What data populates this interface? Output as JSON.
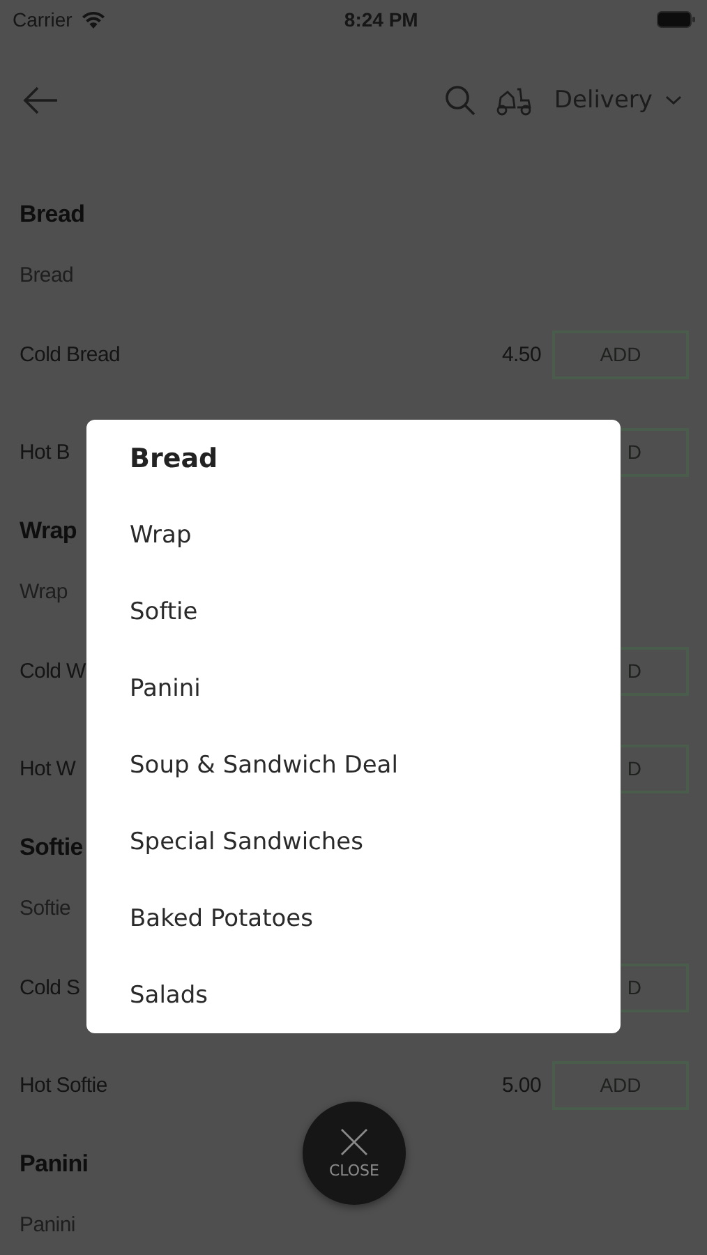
{
  "status_bar": {
    "carrier": "Carrier",
    "time": "8:24 PM"
  },
  "header": {
    "mode_label": "Delivery"
  },
  "menu": {
    "sections": [
      {
        "title": "Bread",
        "subtitle": "Bread",
        "items": [
          {
            "name": "Cold Bread",
            "price": "4.50",
            "add_label": "ADD",
            "covered": false
          },
          {
            "name": "Hot B",
            "add_label": "D",
            "covered": true
          }
        ]
      },
      {
        "title": "Wrap",
        "subtitle": "Wrap",
        "items": [
          {
            "name": "Cold W",
            "add_label": "D",
            "covered": true
          },
          {
            "name": "Hot W",
            "add_label": "D",
            "covered": true
          }
        ]
      },
      {
        "title": "Softie",
        "subtitle": "Softie",
        "items": [
          {
            "name": "Cold S",
            "add_label": "D",
            "covered": true
          },
          {
            "name": "Hot Softie",
            "price": "5.00",
            "add_label": "ADD",
            "covered": false
          }
        ]
      },
      {
        "title": "Panini",
        "subtitle": "Panini"
      }
    ]
  },
  "category_popup": {
    "items": [
      {
        "label": "Bread",
        "selected": true
      },
      {
        "label": "Wrap",
        "selected": false
      },
      {
        "label": "Softie",
        "selected": false
      },
      {
        "label": "Panini",
        "selected": false
      },
      {
        "label": "Soup & Sandwich Deal",
        "selected": false
      },
      {
        "label": "Special Sandwiches",
        "selected": false
      },
      {
        "label": "Baked Potatoes",
        "selected": false
      },
      {
        "label": "Salads",
        "selected": false
      }
    ]
  },
  "close_button": {
    "label": "CLOSE"
  }
}
